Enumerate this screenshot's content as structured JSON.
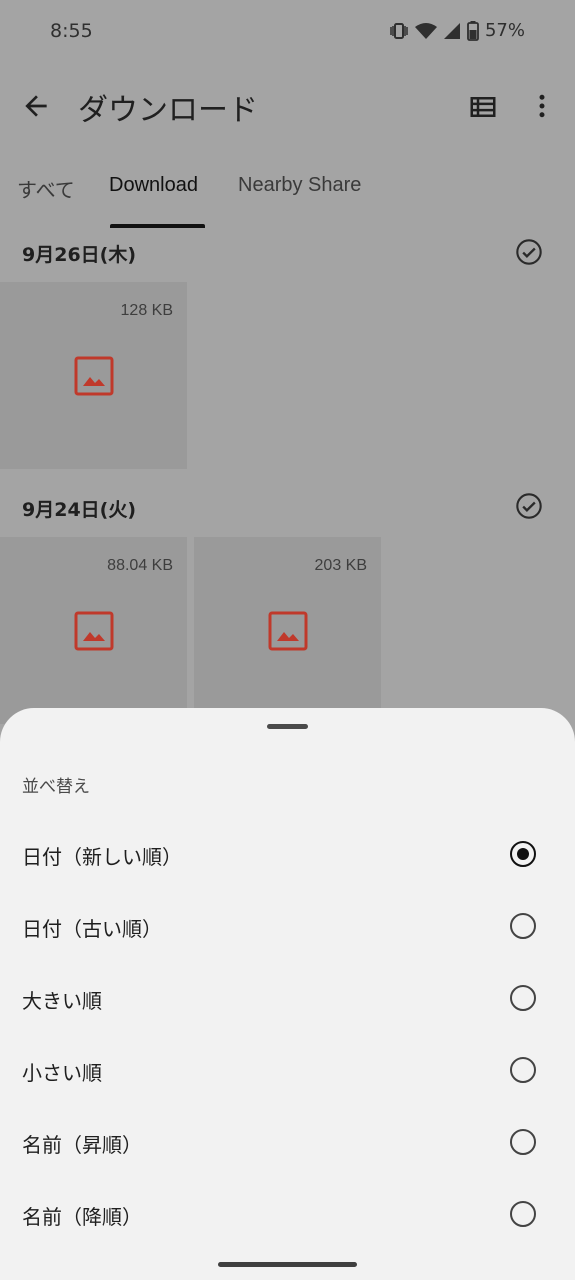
{
  "status_bar": {
    "time": "8:55",
    "battery": "57%"
  },
  "app_bar": {
    "title": "ダウンロード",
    "back_icon": "arrow-back-icon",
    "list_icon": "list-view-icon",
    "more_icon": "more-vert-icon"
  },
  "tabs": [
    {
      "label": "すべて"
    },
    {
      "label": "Download"
    },
    {
      "label": "Nearby Share"
    }
  ],
  "groups": [
    {
      "date": "9月26日(木)",
      "files": [
        {
          "size": "128 KB",
          "icon": "image-icon"
        }
      ]
    },
    {
      "date": "9月24日(火)",
      "files": [
        {
          "size": "88.04 KB",
          "icon": "image-icon"
        },
        {
          "size": "203 KB",
          "icon": "image-icon"
        }
      ]
    }
  ],
  "sort_sheet": {
    "title": "並べ替え",
    "options": [
      {
        "label": "日付（新しい順）",
        "selected": true
      },
      {
        "label": "日付（古い順）",
        "selected": false
      },
      {
        "label": "大きい順",
        "selected": false
      },
      {
        "label": "小さい順",
        "selected": false
      },
      {
        "label": "名前（昇順）",
        "selected": false
      },
      {
        "label": "名前（降順）",
        "selected": false
      }
    ]
  },
  "colors": {
    "image_icon": "#c0392b",
    "scrim": "#a4a4a4",
    "sheet_bg": "#f2f2f2"
  }
}
